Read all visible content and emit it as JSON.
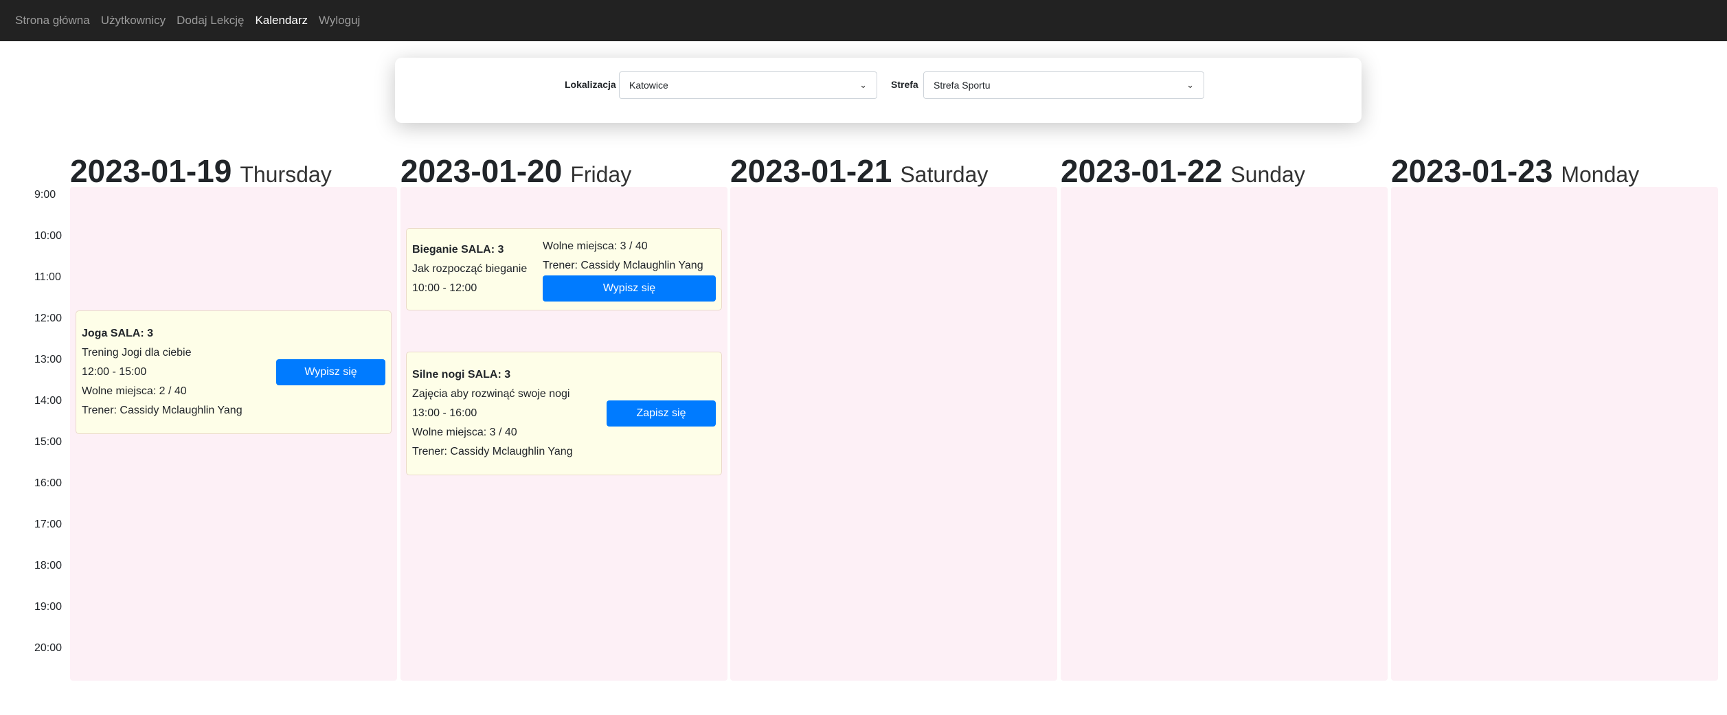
{
  "nav": {
    "items": [
      "Strona główna",
      "Użytkownicy",
      "Dodaj Lekcję",
      "Kalendarz",
      "Wyloguj"
    ],
    "active": "Kalendarz"
  },
  "filter": {
    "location_label": "Lokalizacja",
    "location_value": "Katowice",
    "zone_label": "Strefa",
    "zone_value": "Strefa Sportu"
  },
  "hours": [
    "9:00",
    "10:00",
    "11:00",
    "12:00",
    "13:00",
    "14:00",
    "15:00",
    "16:00",
    "17:00",
    "18:00",
    "19:00",
    "20:00"
  ],
  "days": [
    {
      "date": "2023-01-19",
      "weekday": "Thursday"
    },
    {
      "date": "2023-01-20",
      "weekday": "Friday"
    },
    {
      "date": "2023-01-21",
      "weekday": "Saturday"
    },
    {
      "date": "2023-01-22",
      "weekday": "Sunday"
    },
    {
      "date": "2023-01-23",
      "weekday": "Monday"
    }
  ],
  "events": [
    {
      "day": 0,
      "start": 12,
      "end": 15,
      "title": "Joga SALA: 3",
      "desc": "Trening Jogi dla ciebie",
      "time": "12:00 - 15:00",
      "free": "Wolne miejsca: 2 / 40",
      "trainer": "Trener: Cassidy Mclaughlin Yang",
      "button": "Wypisz się"
    },
    {
      "day": 1,
      "start": 10,
      "end": 12,
      "title": "Bieganie SALA: 3",
      "desc": "Jak rozpocząć bieganie",
      "time": "10:00 - 12:00",
      "free": "Wolne miejsca: 3 / 40",
      "trainer": "Trener: Cassidy Mclaughlin Yang",
      "button": "Wypisz się"
    },
    {
      "day": 1,
      "start": 13,
      "end": 16,
      "title": "Silne nogi SALA: 3",
      "desc": "Zajęcia aby rozwinąć swoje nogi",
      "time": "13:00 - 16:00",
      "free": "Wolne miejsca: 3 / 40",
      "trainer": "Trener: Cassidy Mclaughlin Yang",
      "button": "Zapisz się"
    }
  ],
  "colors": {
    "navbar": "#222222",
    "column": "#fdf0f6",
    "event": "#fefee8",
    "button": "#007bff"
  }
}
